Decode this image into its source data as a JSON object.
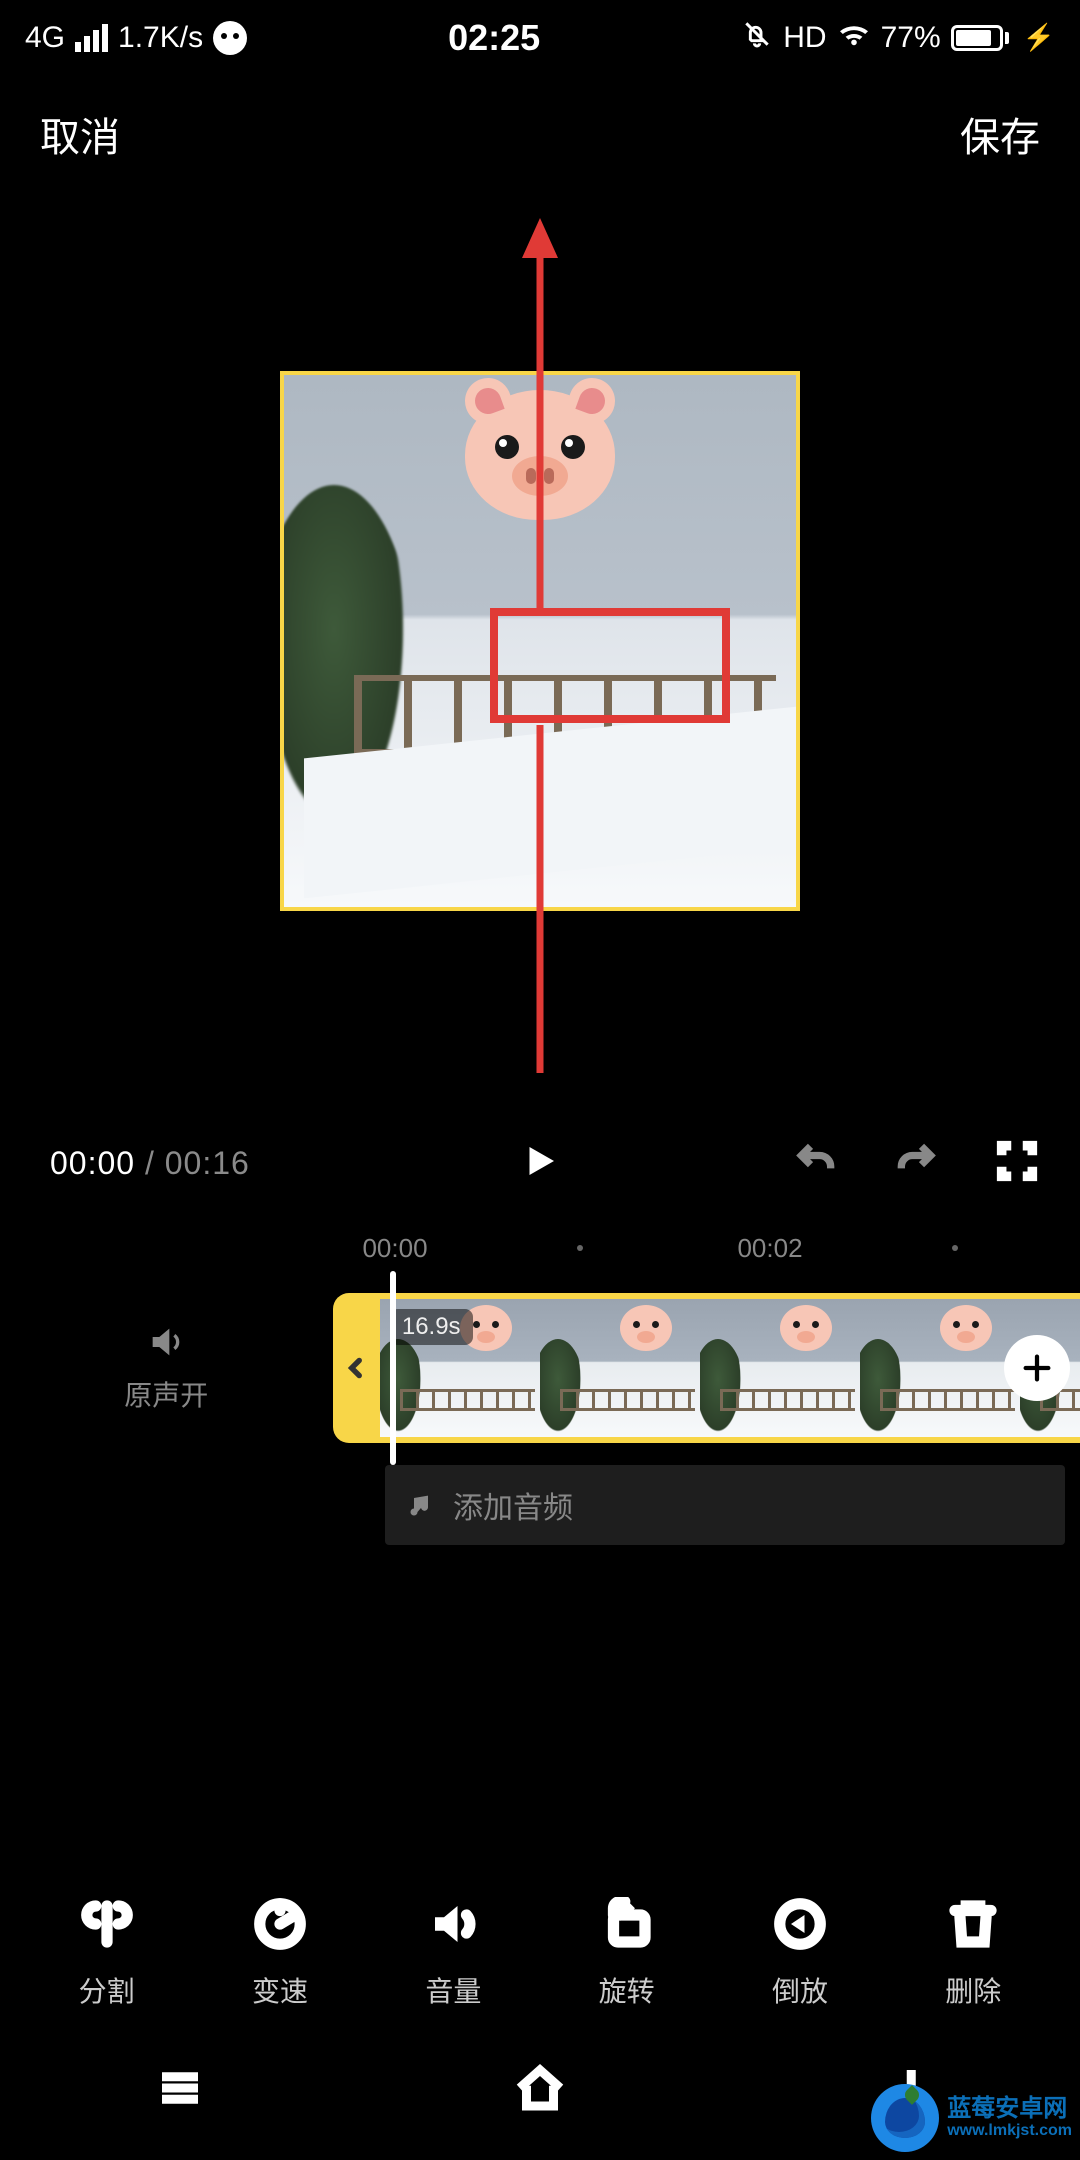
{
  "status": {
    "network": "4G",
    "speed": "1.7K/s",
    "time": "02:25",
    "hd": "HD",
    "battery_pct": "77%"
  },
  "header": {
    "cancel": "取消",
    "save": "保存"
  },
  "playback": {
    "current": "00:00",
    "sep": " / ",
    "total": "00:16"
  },
  "ruler": {
    "t0": "00:00",
    "t1": "00:02"
  },
  "sound": {
    "label": "原声开"
  },
  "clip": {
    "duration": "16.9s"
  },
  "audio_row": {
    "label": "添加音频"
  },
  "tools": {
    "split": "分割",
    "speed": "变速",
    "volume": "音量",
    "rotate": "旋转",
    "reverse": "倒放",
    "delete": "删除"
  },
  "watermark": {
    "name": "蓝莓安卓网",
    "url": "www.lmkjst.com"
  }
}
